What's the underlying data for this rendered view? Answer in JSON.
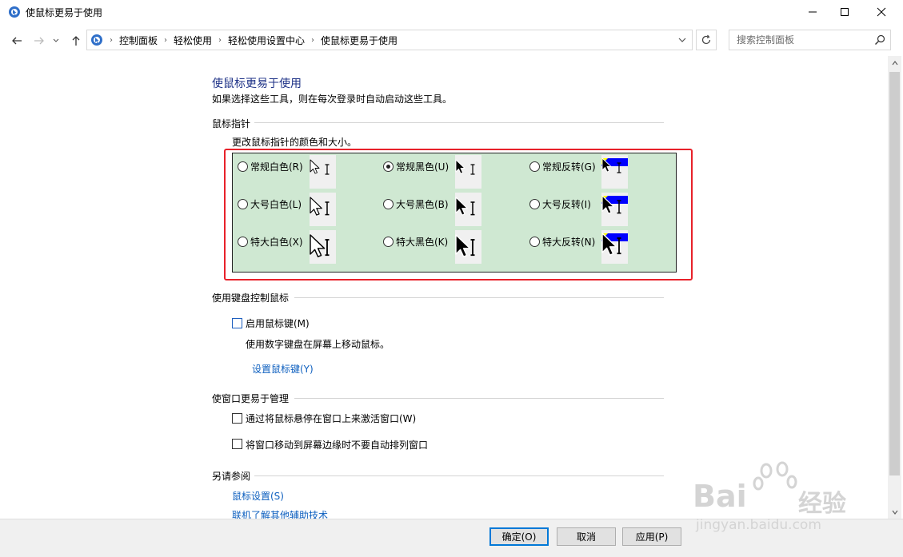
{
  "window": {
    "title": "使鼠标更易于使用"
  },
  "address": {
    "crumbs": [
      "控制面板",
      "轻松使用",
      "轻松使用设置中心",
      "使鼠标更易于使用"
    ],
    "search_placeholder": "搜索控制面板"
  },
  "page": {
    "title": "使鼠标更易于使用",
    "description": "如果选择这些工具，则在每次登录时自动启动这些工具。"
  },
  "pointers": {
    "section_title": "鼠标指针",
    "description": "更改鼠标指针的颜色和大小。",
    "options": [
      {
        "label": "常规白色(R)",
        "checked": false,
        "style": "white",
        "size": "regular"
      },
      {
        "label": "常规黑色(U)",
        "checked": true,
        "style": "black",
        "size": "regular"
      },
      {
        "label": "常规反转(G)",
        "checked": false,
        "style": "invert",
        "size": "regular"
      },
      {
        "label": "大号白色(L)",
        "checked": false,
        "style": "white",
        "size": "large"
      },
      {
        "label": "大号黑色(B)",
        "checked": false,
        "style": "black",
        "size": "large"
      },
      {
        "label": "大号反转(I)",
        "checked": false,
        "style": "invert",
        "size": "large"
      },
      {
        "label": "特大白色(X)",
        "checked": false,
        "style": "white",
        "size": "xlarge"
      },
      {
        "label": "特大黑色(K)",
        "checked": false,
        "style": "black",
        "size": "xlarge"
      },
      {
        "label": "特大反转(N)",
        "checked": false,
        "style": "invert",
        "size": "xlarge"
      }
    ]
  },
  "keyboard": {
    "section_title": "使用键盘控制鼠标",
    "mouse_keys_label": "启用鼠标键(M)",
    "mouse_keys_desc": "使用数字键盘在屏幕上移动鼠标。",
    "setup_link": "设置鼠标键(Y)"
  },
  "windows": {
    "section_title": "使窗口更易于管理",
    "hover_activate_label": "通过将鼠标悬停在窗口上来激活窗口(W)",
    "prevent_arrange_label": "将窗口移动到屏幕边缘时不要自动排列窗口"
  },
  "see_also": {
    "section_title": "另请参阅",
    "mouse_settings_link": "鼠标设置(S)",
    "online_link": "联机了解其他辅助技术"
  },
  "buttons": {
    "ok": "确定(O)",
    "cancel": "取消",
    "apply": "应用(P)"
  },
  "watermark": {
    "brand": "Bai",
    "brand_cn": "经验",
    "url": "jingyan.baidu.com"
  },
  "colors": {
    "title_blue": "#1e3287",
    "link_blue": "#0d5fbf",
    "panel_green": "#cfe8d2",
    "highlight_red": "#e8212a",
    "invert_blue": "#0000ff",
    "invert_yellow": "#ffff00"
  }
}
